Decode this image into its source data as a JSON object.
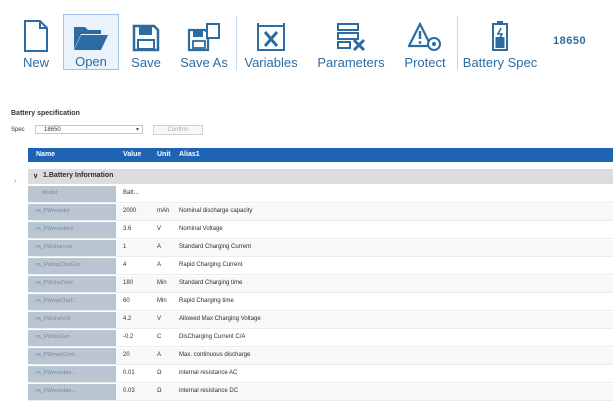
{
  "colors": {
    "accent": "#1e63b4",
    "label": "#2d6ca2"
  },
  "toolbar": {
    "buttons": [
      {
        "label": "New",
        "icon": "new-file-icon"
      },
      {
        "label": "Open",
        "icon": "open-folder-icon",
        "active": true
      },
      {
        "label": "Save",
        "icon": "save-disk-icon"
      },
      {
        "label": "Save As",
        "icon": "save-as-icon"
      },
      {
        "label": "Variables",
        "icon": "variables-icon"
      },
      {
        "label": "Parameters",
        "icon": "parameters-icon"
      },
      {
        "label": "Protect",
        "icon": "protect-warning-icon"
      },
      {
        "label": "Battery Spec",
        "icon": "battery-icon"
      }
    ],
    "badge": "18650"
  },
  "panel": {
    "title": "Battery specification",
    "spec_label": "Spec",
    "spec_value": "18650",
    "confirm_label": "Confirm"
  },
  "grid": {
    "headers": {
      "name": "Name",
      "value": "Value",
      "unit": "Unit",
      "alias": "Alias1"
    },
    "group": "1.Battery Information",
    "rows": [
      {
        "name": "Model",
        "value": "Batt...",
        "unit": "",
        "alias": ""
      },
      {
        "name": "m_FWresistor",
        "value": "2000",
        "unit": "mAh",
        "alias": "Nominal discharge capacity"
      },
      {
        "name": "m_FWresistorV",
        "value": "3.6",
        "unit": "V",
        "alias": "Nominal Voltage"
      },
      {
        "name": "m_FWcharcurr",
        "value": "1",
        "unit": "A",
        "alias": "Standard Charging Current"
      },
      {
        "name": "m_FWrapChaCurr",
        "value": "4",
        "unit": "A",
        "alias": "Rapid Charging Current"
      },
      {
        "name": "m_FWchaTime",
        "value": "180",
        "unit": "Min",
        "alias": "Standard Charging time"
      },
      {
        "name": "m_FWrapChaT...",
        "value": "60",
        "unit": "Min",
        "alias": "Rapid Charging time"
      },
      {
        "name": "m_FWchaVolt",
        "value": "4.2",
        "unit": "V",
        "alias": "Allowed Max Charging Voltage"
      },
      {
        "name": "m_FWdisCurr",
        "value": "-0.2",
        "unit": "C",
        "alias": "DisCharging Current C/A"
      },
      {
        "name": "m_FWmaxCont...",
        "value": "20",
        "unit": "A",
        "alias": "Max. continuous discharge"
      },
      {
        "name": "m_FWresistan...",
        "value": "0.01",
        "unit": "Ω",
        "alias": "internal resistance AC"
      },
      {
        "name": "m_FWresistan...",
        "value": "0.03",
        "unit": "Ω",
        "alias": "internal resistance DC"
      }
    ]
  }
}
